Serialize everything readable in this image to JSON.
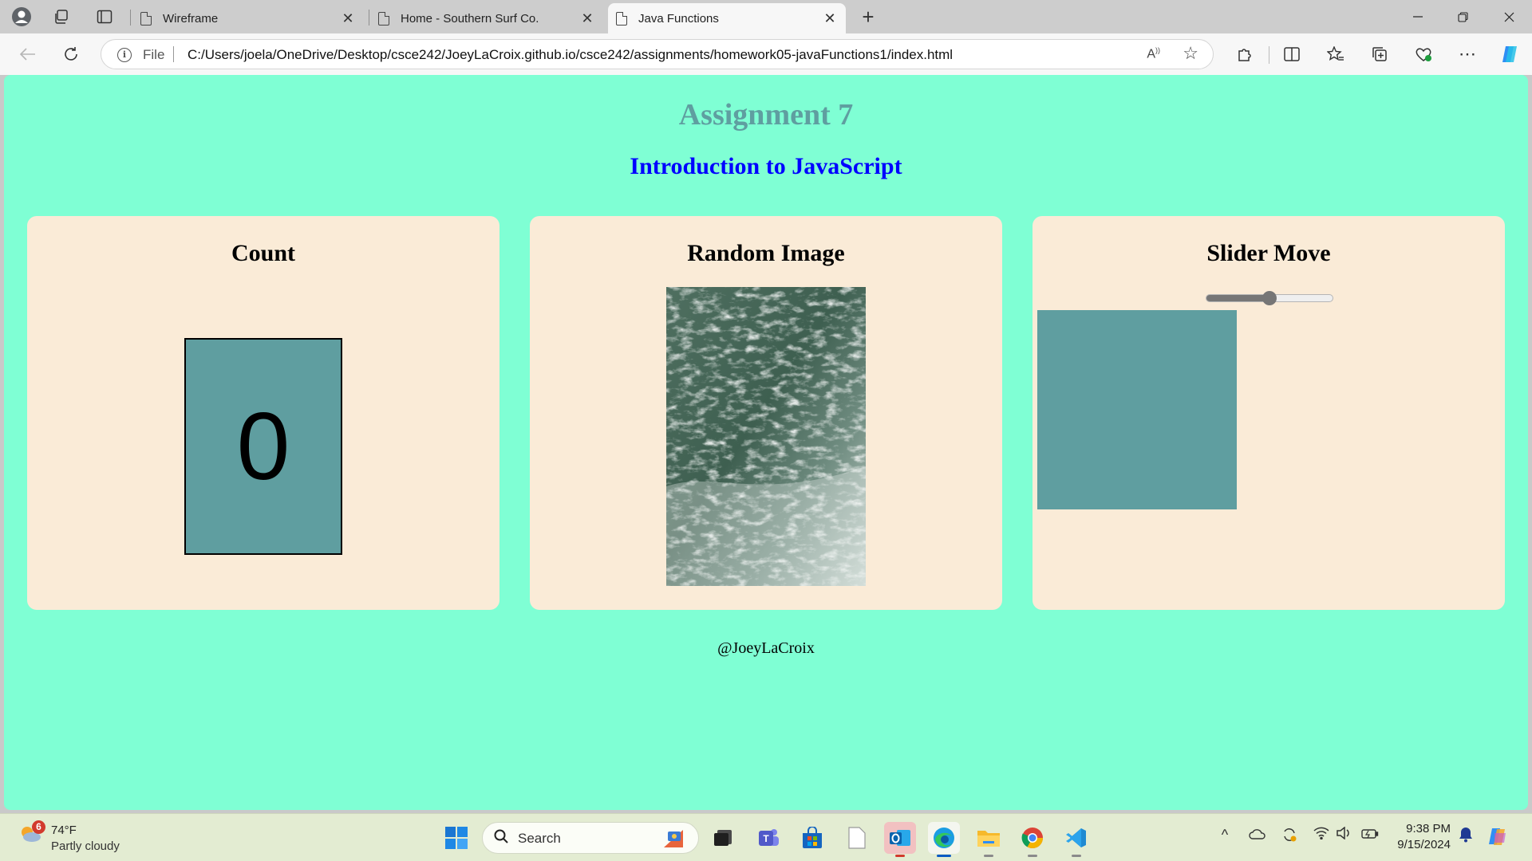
{
  "browser": {
    "tabs": [
      {
        "title": "Wireframe",
        "active": false
      },
      {
        "title": "Home - Southern Surf Co.",
        "active": false
      },
      {
        "title": "Java Functions",
        "active": true
      }
    ],
    "new_tab_symbol": "+",
    "close_symbol": "✕",
    "address": {
      "scheme_label": "File",
      "url": "C:/Users/joela/OneDrive/Desktop/csce242/JoeyLaCroix.github.io/csce242/assignments/homework05-javaFunctions1/index.html"
    },
    "icons": [
      "profile-icon",
      "workspaces-icon",
      "tab-actions-icon",
      "back-icon",
      "refresh-icon",
      "info-icon",
      "read-aloud-icon",
      "favorite-star-icon",
      "extensions-icon",
      "split-screen-icon",
      "favorites-icon",
      "collections-icon",
      "browser-essentials-icon",
      "more-icon",
      "copilot-icon"
    ]
  },
  "page": {
    "heading": "Assignment 7",
    "subheading": "Introduction to JavaScript",
    "count_card": {
      "title": "Count",
      "value": "0"
    },
    "image_card": {
      "title": "Random Image",
      "image_subject": "ocean-waves"
    },
    "slider_card": {
      "title": "Slider Move",
      "slider_fraction": 0.5
    },
    "footer": "@JoeyLaCroix",
    "colors": {
      "background": "#7fffd4",
      "heading": "#5f9ea0",
      "subheading": "#0000ff",
      "card": "#faebd7",
      "box": "#5f9ea0"
    }
  },
  "taskbar": {
    "weather": {
      "badge": "6",
      "temperature": "74°F",
      "condition": "Partly cloudy"
    },
    "search_placeholder": "Search",
    "apps": [
      "start-icon",
      "task-view-icon",
      "teams-icon",
      "store-icon",
      "file-icon",
      "outlook-icon",
      "edge-icon",
      "file-explorer-icon",
      "chrome-icon",
      "vscode-icon"
    ],
    "time": "9:38 PM",
    "date": "9/15/2024"
  }
}
